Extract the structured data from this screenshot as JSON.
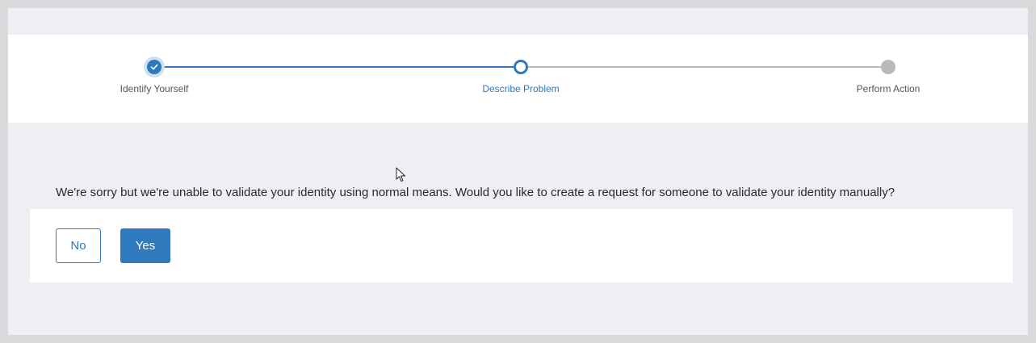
{
  "stepper": {
    "steps": [
      {
        "label": "Identify Yourself",
        "state": "completed"
      },
      {
        "label": "Describe Problem",
        "state": "current"
      },
      {
        "label": "Perform Action",
        "state": "pending"
      }
    ],
    "completed_icon": "check-icon"
  },
  "prompt": {
    "message": "We're sorry but we're unable to validate your identity using normal means. Would you like to create a request for someone to validate your identity manually?"
  },
  "actions": {
    "no_label": "No",
    "yes_label": "Yes"
  },
  "colors": {
    "accent": "#2f79bd",
    "pending": "#b9b9b9",
    "background": "#eeeff2",
    "panel": "#ffffff"
  }
}
